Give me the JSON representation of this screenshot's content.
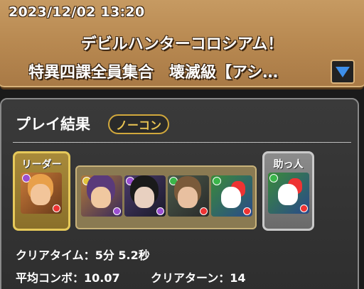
{
  "header": {
    "datetime": "2023/12/02 13:20",
    "quest_name": "デビルハンターコロシアム！",
    "dungeon_name": "特異四課全員集合　壊滅級【アシ…",
    "expand_icon": "triangle-down-icon"
  },
  "result": {
    "title": "プレイ結果",
    "badge": "ノーコン",
    "leader_label": "リーダー",
    "helper_label": "助っ人",
    "clear_time_label": "クリアタイム：",
    "clear_time_value": "5分 5.2秒",
    "avg_combo_label": "平均コンボ：",
    "avg_combo_value": "10.07",
    "clear_turn_label": "クリアターン：",
    "clear_turn_value": "14"
  },
  "colors": {
    "header_bg": "#b98a52",
    "panel_bg": "#333333",
    "badge_gold": "#e9c453",
    "expand_blue": "#3d8ee8"
  }
}
